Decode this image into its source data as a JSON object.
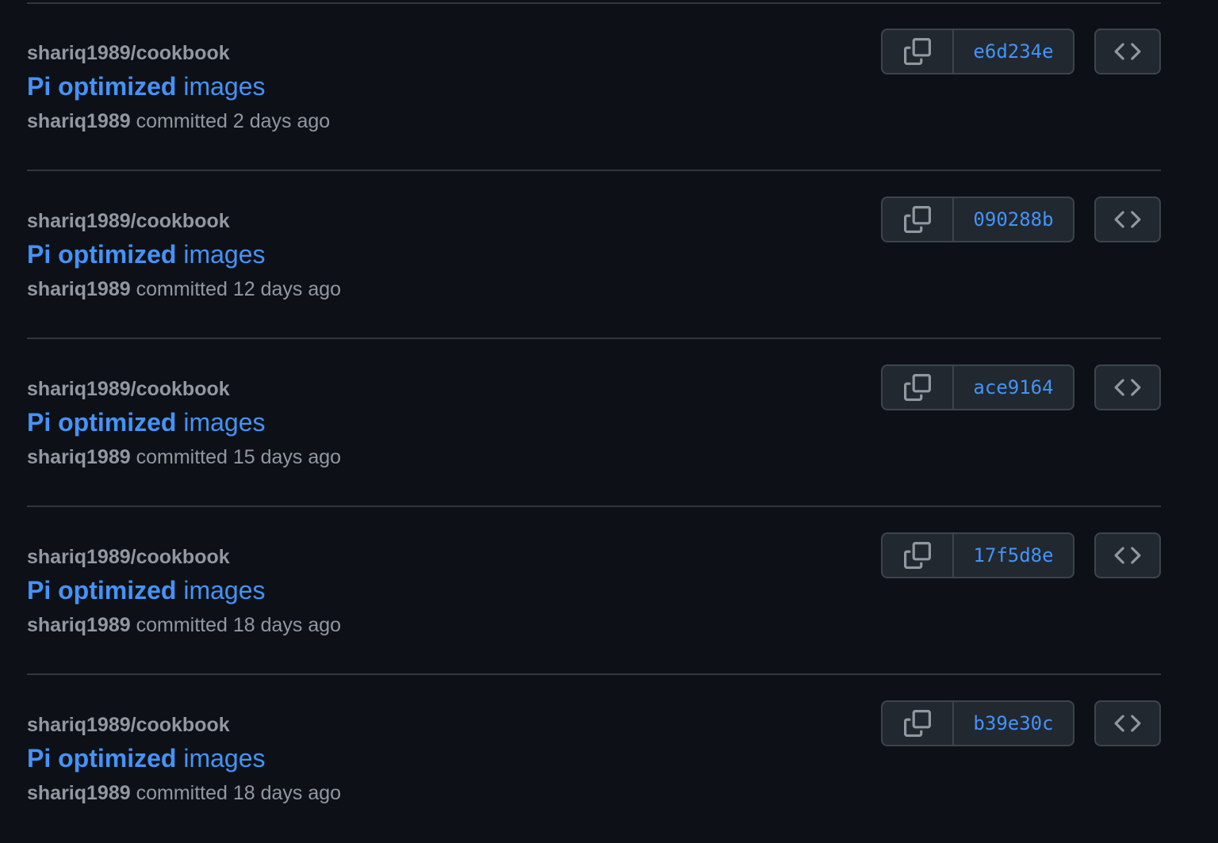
{
  "commits": [
    {
      "repo": "shariq1989/cookbook",
      "message_bold": "Pi optimized",
      "message_rest": " images",
      "author": "shariq1989",
      "committed_text": " committed 2 days ago",
      "sha": "e6d234e",
      "copy_icon": "copy-icon",
      "browse_icon": "code-icon"
    },
    {
      "repo": "shariq1989/cookbook",
      "message_bold": "Pi optimized",
      "message_rest": " images",
      "author": "shariq1989",
      "committed_text": " committed 12 days ago",
      "sha": "090288b",
      "copy_icon": "copy-icon",
      "browse_icon": "code-icon"
    },
    {
      "repo": "shariq1989/cookbook",
      "message_bold": "Pi optimized",
      "message_rest": " images",
      "author": "shariq1989",
      "committed_text": " committed 15 days ago",
      "sha": "ace9164",
      "copy_icon": "copy-icon",
      "browse_icon": "code-icon"
    },
    {
      "repo": "shariq1989/cookbook",
      "message_bold": "Pi optimized",
      "message_rest": " images",
      "author": "shariq1989",
      "committed_text": " committed 18 days ago",
      "sha": "17f5d8e",
      "copy_icon": "copy-icon",
      "browse_icon": "code-icon"
    },
    {
      "repo": "shariq1989/cookbook",
      "message_bold": "Pi optimized",
      "message_rest": " images",
      "author": "shariq1989",
      "committed_text": " committed 18 days ago",
      "sha": "b39e30c",
      "copy_icon": "copy-icon",
      "browse_icon": "code-icon"
    }
  ],
  "colors": {
    "background": "#0d1117",
    "link": "#4493f8",
    "muted": "#9198a1",
    "border": "#3d444d"
  }
}
